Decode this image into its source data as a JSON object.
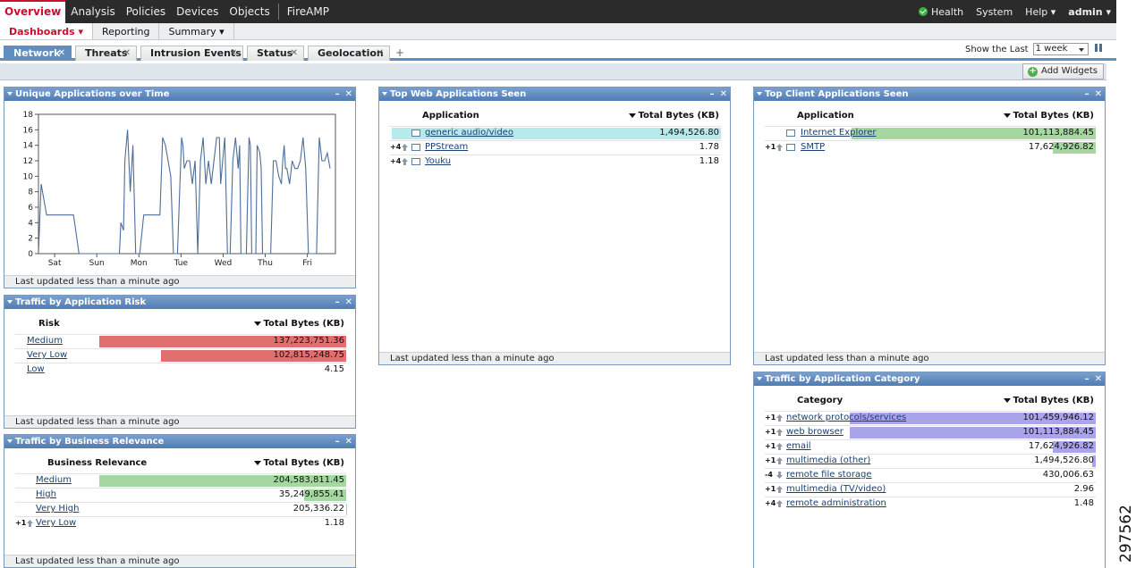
{
  "topnav": {
    "tabs": [
      "Overview",
      "Analysis",
      "Policies",
      "Devices",
      "Objects",
      "FireAMP"
    ],
    "active": "Overview",
    "right": {
      "health": "Health",
      "system": "System",
      "help": "Help ▾",
      "admin": "admin ▾"
    }
  },
  "subnav": {
    "tabs": [
      "Dashboards ▾",
      "Reporting",
      "Summary ▾"
    ],
    "active": "Dashboards ▾"
  },
  "dashboard_tabs": [
    {
      "label": "Network",
      "active": true
    },
    {
      "label": "Threats",
      "active": false
    },
    {
      "label": "Intrusion Events",
      "active": false
    },
    {
      "label": "Status",
      "active": false
    },
    {
      "label": "Geolocation",
      "active": false
    }
  ],
  "add_tab": "+",
  "show_last": {
    "label": "Show the Last",
    "value": "1 week"
  },
  "add_widgets": "Add Widgets",
  "footer_text": "Last updated less than a minute ago",
  "widget_controls": {
    "minimize": "–",
    "close": "✕"
  },
  "close_x": "✕",
  "side_code": "297562",
  "unique_apps": {
    "title": "Unique Applications over Time",
    "chart_data": {
      "type": "line",
      "x_categories": [
        "Sat",
        "Sun",
        "Mon",
        "Tue",
        "Wed",
        "Thu",
        "Fri"
      ],
      "ylim": [
        0,
        18
      ],
      "yticks": [
        0,
        2,
        4,
        6,
        8,
        10,
        12,
        14,
        16,
        18
      ],
      "series": [
        {
          "values": [
            [
              0,
              0
            ],
            [
              0.1,
              9
            ],
            [
              0.3,
              5
            ],
            [
              0.6,
              5
            ],
            [
              1.3,
              5
            ],
            [
              1.5,
              0
            ],
            [
              2.4,
              0
            ],
            [
              2.6,
              0
            ],
            [
              3.0,
              0
            ],
            [
              3.05,
              4
            ],
            [
              3.15,
              3
            ],
            [
              3.2,
              12
            ],
            [
              3.3,
              16
            ],
            [
              3.4,
              8
            ],
            [
              3.5,
              14
            ],
            [
              3.6,
              0
            ],
            [
              3.75,
              0
            ],
            [
              3.9,
              5
            ],
            [
              4.0,
              5
            ],
            [
              4.5,
              5
            ],
            [
              4.6,
              15
            ],
            [
              4.7,
              14
            ],
            [
              4.8,
              12
            ],
            [
              4.9,
              10
            ],
            [
              5.0,
              0
            ],
            [
              5.15,
              0
            ],
            [
              5.3,
              15
            ],
            [
              5.35,
              14
            ],
            [
              5.4,
              11
            ],
            [
              5.5,
              12
            ],
            [
              5.6,
              12
            ],
            [
              5.7,
              9
            ],
            [
              5.8,
              12
            ],
            [
              5.9,
              0
            ],
            [
              6.0,
              12
            ],
            [
              6.1,
              15
            ],
            [
              6.2,
              9
            ],
            [
              6.3,
              12
            ],
            [
              6.4,
              9
            ],
            [
              6.5,
              12
            ],
            [
              6.6,
              15
            ],
            [
              6.7,
              15
            ],
            [
              6.75,
              9
            ],
            [
              6.85,
              13
            ],
            [
              6.9,
              15
            ],
            [
              7.0,
              0
            ],
            [
              7.1,
              0
            ],
            [
              7.2,
              12
            ],
            [
              7.3,
              15
            ],
            [
              7.4,
              11
            ],
            [
              7.45,
              14
            ],
            [
              7.5,
              0
            ],
            [
              7.6,
              0
            ],
            [
              7.7,
              0
            ],
            [
              7.8,
              15
            ],
            [
              7.85,
              14
            ],
            [
              7.9,
              0
            ],
            [
              8.0,
              0
            ],
            [
              8.05,
              0
            ],
            [
              8.1,
              14
            ],
            [
              8.2,
              13
            ],
            [
              8.25,
              11
            ],
            [
              8.3,
              0
            ],
            [
              8.6,
              0
            ],
            [
              8.7,
              12
            ],
            [
              8.8,
              12
            ],
            [
              8.9,
              10
            ],
            [
              9.0,
              9
            ],
            [
              9.05,
              12
            ],
            [
              9.1,
              14
            ],
            [
              9.15,
              11
            ],
            [
              9.2,
              11
            ],
            [
              9.3,
              9
            ],
            [
              9.4,
              12
            ],
            [
              9.5,
              11
            ],
            [
              9.6,
              11
            ],
            [
              9.7,
              12
            ],
            [
              9.8,
              15
            ],
            [
              9.9,
              11
            ],
            [
              10.0,
              0
            ],
            [
              10.3,
              0
            ],
            [
              10.4,
              15
            ],
            [
              10.5,
              12
            ],
            [
              10.6,
              12
            ],
            [
              10.7,
              13
            ],
            [
              10.8,
              11
            ]
          ]
        }
      ]
    }
  },
  "risk": {
    "title": "Traffic by Application Risk",
    "col1": "Risk",
    "col2": "Total Bytes (KB)",
    "color": "#e26f6f",
    "rows": [
      {
        "label": "Medium",
        "value": "137,223,751.36",
        "frac": 1.0
      },
      {
        "label": "Very Low",
        "value": "102,815,248.75",
        "frac": 0.749
      },
      {
        "label": "Low",
        "value": "4.15",
        "frac": 0.0
      }
    ]
  },
  "business": {
    "title": "Traffic by Business Relevance",
    "col1": "Business Relevance",
    "col2": "Total Bytes (KB)",
    "color": "#a4d8a0",
    "rows": [
      {
        "label": "Medium",
        "value": "204,583,811.45",
        "frac": 1.0,
        "chg": ""
      },
      {
        "label": "High",
        "value": "35,249,855.41",
        "frac": 0.172,
        "chg": ""
      },
      {
        "label": "Very High",
        "value": "205,336.22",
        "frac": 0.001,
        "chg": ""
      },
      {
        "label": "Very Low",
        "value": "1.18",
        "frac": 0.0,
        "chg": "+1"
      }
    ]
  },
  "web": {
    "title": "Top Web Applications Seen",
    "col1": "Application",
    "col2": "Total Bytes (KB)",
    "color": "#b7eaea",
    "rows": [
      {
        "label": "generic audio/video",
        "value": "1,494,526.80",
        "frac": 1.0,
        "chg": ""
      },
      {
        "label": "PPStream",
        "value": "1.78",
        "frac": 0.0,
        "chg": "+4"
      },
      {
        "label": "Youku",
        "value": "1.18",
        "frac": 0.0,
        "chg": "+4"
      }
    ]
  },
  "client": {
    "title": "Top Client Applications Seen",
    "col1": "Application",
    "col2": "Total Bytes (KB)",
    "color": "#a4d8a0",
    "rows": [
      {
        "label": "Internet Explorer",
        "value": "101,113,884.45",
        "frac": 0.78,
        "chg": ""
      },
      {
        "label": "SMTP",
        "value": "17,624,926.82",
        "frac": 0.136,
        "chg": "+1"
      }
    ]
  },
  "category": {
    "title": "Traffic by Application Category",
    "col1": "Category",
    "col2": "Total Bytes (KB)",
    "color": "#aaa4ea",
    "rows": [
      {
        "label": "network protocols/services",
        "value": "101,459,946.12",
        "frac": 0.78,
        "chg": "+1",
        "dir": "up"
      },
      {
        "label": "web browser",
        "value": "101,113,884.45",
        "frac": 0.78,
        "chg": "+1",
        "dir": "up"
      },
      {
        "label": "email",
        "value": "17,624,926.82",
        "frac": 0.136,
        "chg": "+1",
        "dir": "up"
      },
      {
        "label": "multimedia (other)",
        "value": "1,494,526.80",
        "frac": 0.012,
        "chg": "+1",
        "dir": "up"
      },
      {
        "label": "remote file storage",
        "value": "430,006.63",
        "frac": 0.0,
        "chg": "-4",
        "dir": "dn"
      },
      {
        "label": "multimedia (TV/video)",
        "value": "2.96",
        "frac": 0.0,
        "chg": "+1",
        "dir": "up"
      },
      {
        "label": "remote administration",
        "value": "1.48",
        "frac": 0.0,
        "chg": "+4",
        "dir": "up"
      }
    ]
  }
}
